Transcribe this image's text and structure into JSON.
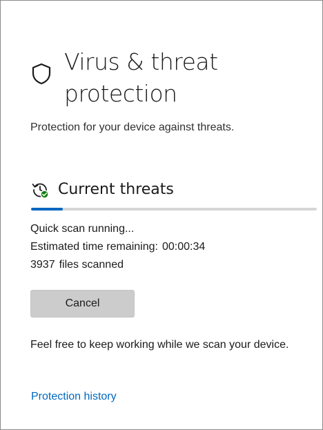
{
  "page": {
    "icon": "shield-icon",
    "title": "Virus & threat protection",
    "subtitle": "Protection for your device against threats."
  },
  "current_threats": {
    "icon": "refresh-check-icon",
    "title": "Current threats",
    "progress_fraction": 0.11,
    "accent_color": "#0067c0",
    "status": "Quick scan running...",
    "time_label": "Estimated time remaining:",
    "time_value": "00:00:34",
    "files_count": "3937",
    "files_label": "files scanned",
    "cancel_label": "Cancel",
    "note": "Feel free to keep working while we scan your device."
  },
  "links": {
    "protection_history": "Protection history"
  }
}
